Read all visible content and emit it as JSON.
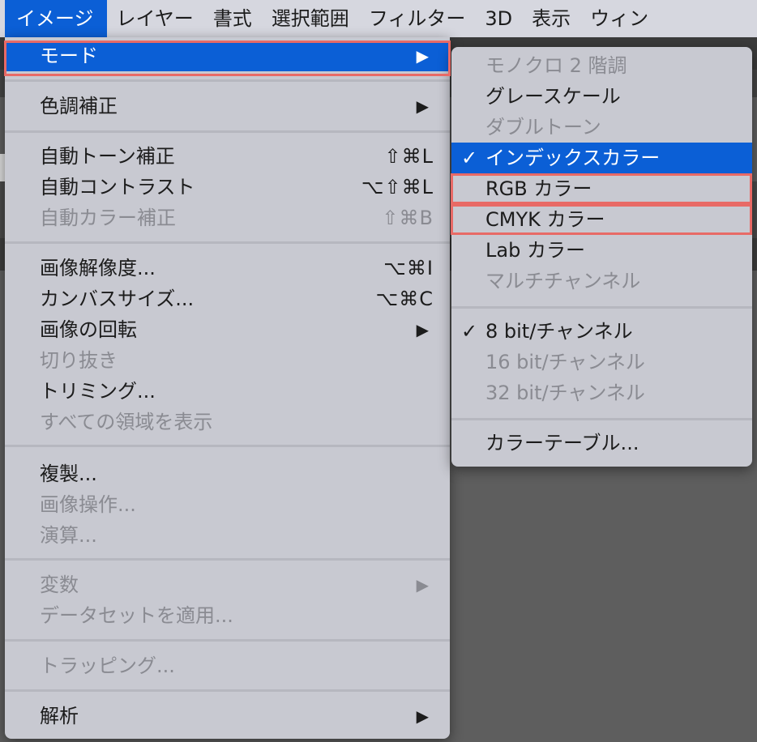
{
  "menubar": {
    "items": [
      "イメージ",
      "レイヤー",
      "書式",
      "選択範囲",
      "フィルター",
      "3D",
      "表示",
      "ウィン"
    ]
  },
  "image_menu": {
    "items": [
      {
        "label": "モード",
        "submenu": true,
        "state": "selected"
      },
      {
        "label": "色調補正",
        "submenu": true
      },
      {
        "label": "自動トーン補正",
        "shortcut": "⇧⌘L"
      },
      {
        "label": "自動コントラスト",
        "shortcut": "⌥⇧⌘L"
      },
      {
        "label": "自動カラー補正",
        "shortcut": "⇧⌘B",
        "state": "disabled"
      },
      {
        "label": "画像解像度...",
        "shortcut": "⌥⌘I"
      },
      {
        "label": "カンバスサイズ...",
        "shortcut": "⌥⌘C"
      },
      {
        "label": "画像の回転",
        "submenu": true
      },
      {
        "label": "切り抜き",
        "state": "disabled"
      },
      {
        "label": "トリミング..."
      },
      {
        "label": "すべての領域を表示",
        "state": "disabled"
      },
      {
        "label": "複製..."
      },
      {
        "label": "画像操作...",
        "state": "disabled"
      },
      {
        "label": "演算...",
        "state": "disabled"
      },
      {
        "label": "変数",
        "submenu": true,
        "state": "disabled"
      },
      {
        "label": "データセットを適用...",
        "state": "disabled"
      },
      {
        "label": "トラッピング...",
        "state": "disabled"
      },
      {
        "label": "解析",
        "submenu": true
      }
    ],
    "submenu_arrow": "▶"
  },
  "mode_submenu": {
    "items": [
      {
        "label": "モノクロ 2 階調",
        "state": "disabled"
      },
      {
        "label": "グレースケール"
      },
      {
        "label": "ダブルトーン",
        "state": "disabled"
      },
      {
        "label": "インデックスカラー",
        "checked": true,
        "state": "selected"
      },
      {
        "label": "RGB カラー"
      },
      {
        "label": "CMYK カラー"
      },
      {
        "label": "Lab カラー"
      },
      {
        "label": "マルチチャンネル",
        "state": "disabled"
      },
      {
        "label": "8 bit/チャンネル",
        "checked": true
      },
      {
        "label": "16 bit/チャンネル",
        "state": "disabled"
      },
      {
        "label": "32 bit/チャンネル",
        "state": "disabled"
      },
      {
        "label": "カラーテーブル..."
      }
    ],
    "check_mark": "✓"
  },
  "colors": {
    "accent": "#0b5fd6",
    "highlight_box": "#e86a66",
    "menu_bg": "#c8c9d1"
  }
}
